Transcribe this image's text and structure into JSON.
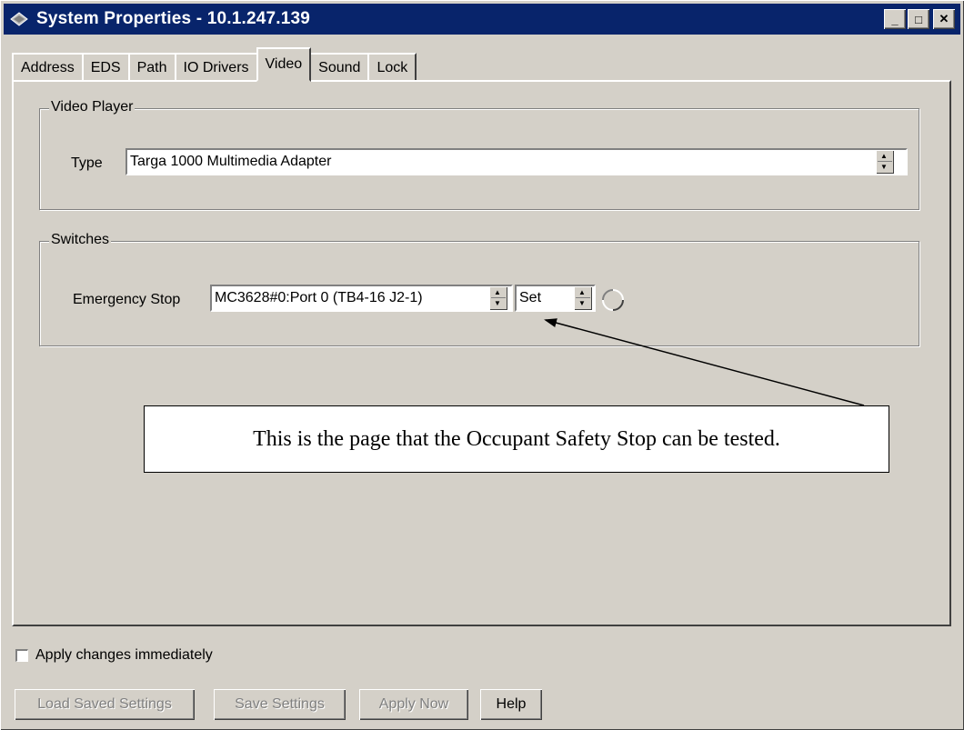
{
  "window": {
    "title": "System Properties - 10.1.247.139"
  },
  "title_controls": {
    "minimize": "_",
    "maximize": "□",
    "close": "✕"
  },
  "tabs": [
    {
      "label": "Address"
    },
    {
      "label": "EDS"
    },
    {
      "label": "Path"
    },
    {
      "label": "IO Drivers"
    },
    {
      "label": "Video"
    },
    {
      "label": "Sound"
    },
    {
      "label": "Lock"
    }
  ],
  "active_tab": "Video",
  "video_player": {
    "group_label": "Video Player",
    "type_label": "Type",
    "type_value": "Targa 1000 Multimedia Adapter"
  },
  "switches": {
    "group_label": "Switches",
    "estop_label": "Emergency Stop",
    "estop_value": "MC3628#0:Port 0 (TB4-16 J2-1)",
    "state_value": "Set"
  },
  "callout": {
    "text": "This is the page that the Occupant Safety Stop can be tested."
  },
  "apply_immediately": {
    "label": "Apply changes immediately",
    "checked": false
  },
  "buttons": {
    "load": "Load Saved Settings",
    "save": "Save Settings",
    "apply": "Apply Now",
    "help": "Help"
  }
}
